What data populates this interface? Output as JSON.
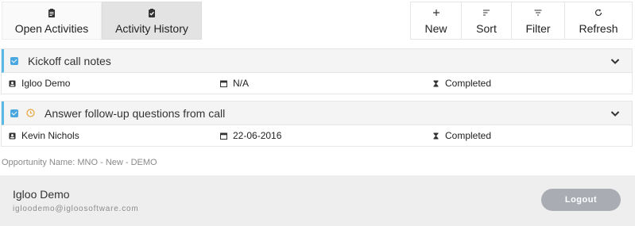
{
  "tabs": [
    {
      "label": "Open Activities",
      "icon": "clipboard-icon",
      "active": false
    },
    {
      "label": "Activity History",
      "icon": "clipboard-check-icon",
      "active": true
    }
  ],
  "toolbar": {
    "new_label": "New",
    "sort_label": "Sort",
    "filter_label": "Filter",
    "refresh_label": "Refresh"
  },
  "activities": [
    {
      "title": "Kickoff call notes",
      "contact": "Igloo Demo",
      "date": "N/A",
      "status": "Completed",
      "has_clock": false
    },
    {
      "title": "Answer follow-up questions from call",
      "contact": "Kevin Nichols",
      "date": "22-06-2016",
      "status": "Completed",
      "has_clock": true
    }
  ],
  "opportunity_text": "Opportunity Name: MNO - New - DEMO",
  "footer": {
    "user_name": "Igloo Demo",
    "user_email": "igloodemo@igloosoftware.com",
    "logout_label": "Logout"
  },
  "colors": {
    "accent": "#59b8e6",
    "checkbox": "#4aa7e0",
    "clock": "#e8a23b",
    "logout_bg": "#a9adb3"
  }
}
